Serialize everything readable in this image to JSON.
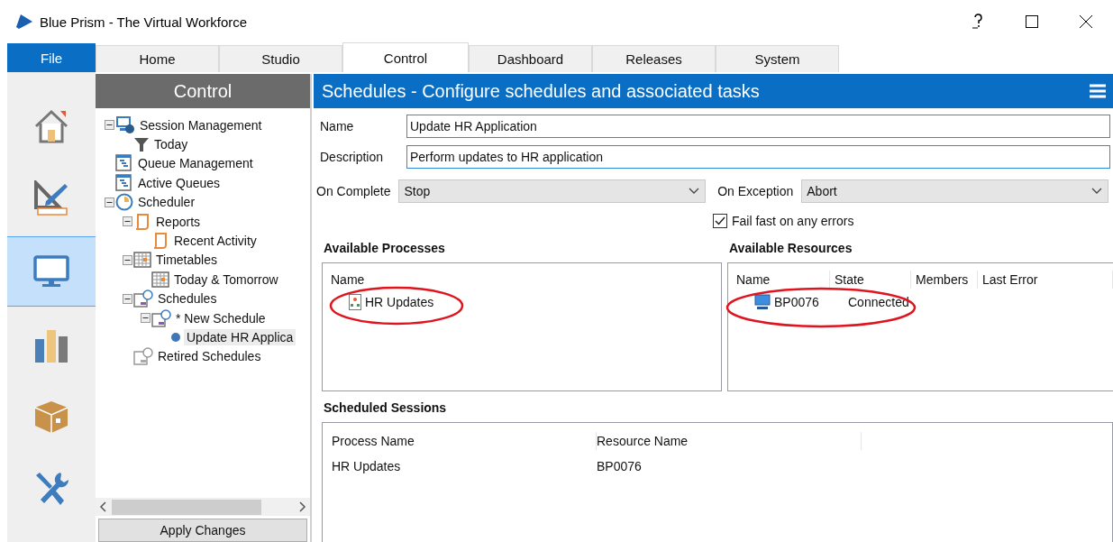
{
  "window": {
    "title": "Blue Prism - The Virtual Workforce"
  },
  "file_button": "File",
  "tabs": [
    {
      "label": "Home",
      "selected": false
    },
    {
      "label": "Studio",
      "selected": false
    },
    {
      "label": "Control",
      "selected": true
    },
    {
      "label": "Dashboard",
      "selected": false
    },
    {
      "label": "Releases",
      "selected": false
    },
    {
      "label": "System",
      "selected": false
    }
  ],
  "nav_rail": [
    {
      "kind": "home",
      "selected": false
    },
    {
      "kind": "studio",
      "selected": false
    },
    {
      "kind": "control",
      "selected": true
    },
    {
      "kind": "dashboard",
      "selected": false
    },
    {
      "kind": "releases",
      "selected": false
    },
    {
      "kind": "system",
      "selected": false
    }
  ],
  "tree_panel": {
    "title": "Control",
    "items": [
      {
        "label": "Session Management",
        "kind": "session",
        "expanded": true,
        "selected": false,
        "children": [
          {
            "label": "Today",
            "kind": "filter",
            "selected": false
          }
        ]
      },
      {
        "label": "Queue Management",
        "kind": "queue",
        "selected": false
      },
      {
        "label": "Active Queues",
        "kind": "queue",
        "selected": false
      },
      {
        "label": "Scheduler",
        "kind": "clock",
        "expanded": true,
        "selected": false,
        "children": [
          {
            "label": "Reports",
            "kind": "report",
            "expanded": true,
            "selected": false,
            "children": [
              {
                "label": "Recent Activity",
                "kind": "report",
                "selected": false
              }
            ]
          },
          {
            "label": "Timetables",
            "kind": "calendar",
            "expanded": true,
            "selected": false,
            "children": [
              {
                "label": "Today & Tomorrow",
                "kind": "calendar",
                "selected": false
              }
            ]
          },
          {
            "label": "Schedules",
            "kind": "schedule",
            "expanded": true,
            "selected": false,
            "children": [
              {
                "label": "* New Schedule",
                "kind": "schedule",
                "expanded": true,
                "selected": false,
                "children": [
                  {
                    "label": "Update HR Applica",
                    "kind": "dot",
                    "selected": true
                  }
                ]
              }
            ]
          },
          {
            "label": "Retired Schedules",
            "kind": "retired",
            "selected": false
          }
        ]
      }
    ],
    "apply_button": "Apply Changes"
  },
  "main": {
    "title": "Schedules - Configure schedules and associated tasks",
    "name": {
      "label": "Name",
      "value": "Update HR Application"
    },
    "description": {
      "label": "Description",
      "value": "Perform updates to HR application"
    },
    "on_complete": {
      "label": "On Complete",
      "value": "Stop"
    },
    "on_exception": {
      "label": "On Exception",
      "value": "Abort"
    },
    "fail_fast": {
      "label": "Fail fast on any errors",
      "checked": true
    },
    "processes": {
      "title": "Available Processes",
      "columns": [
        "Name"
      ],
      "rows": [
        {
          "name": "HR Updates"
        }
      ]
    },
    "resources": {
      "title": "Available Resources",
      "columns": [
        "Name",
        "State",
        "Members",
        "Last Error"
      ],
      "rows": [
        {
          "name": "BP0076",
          "state": "Connected"
        }
      ]
    },
    "sessions": {
      "title": "Scheduled Sessions",
      "columns": [
        "Process Name",
        "Resource Name"
      ],
      "rows": [
        {
          "process": "HR Updates",
          "resource": "BP0076"
        }
      ]
    }
  }
}
